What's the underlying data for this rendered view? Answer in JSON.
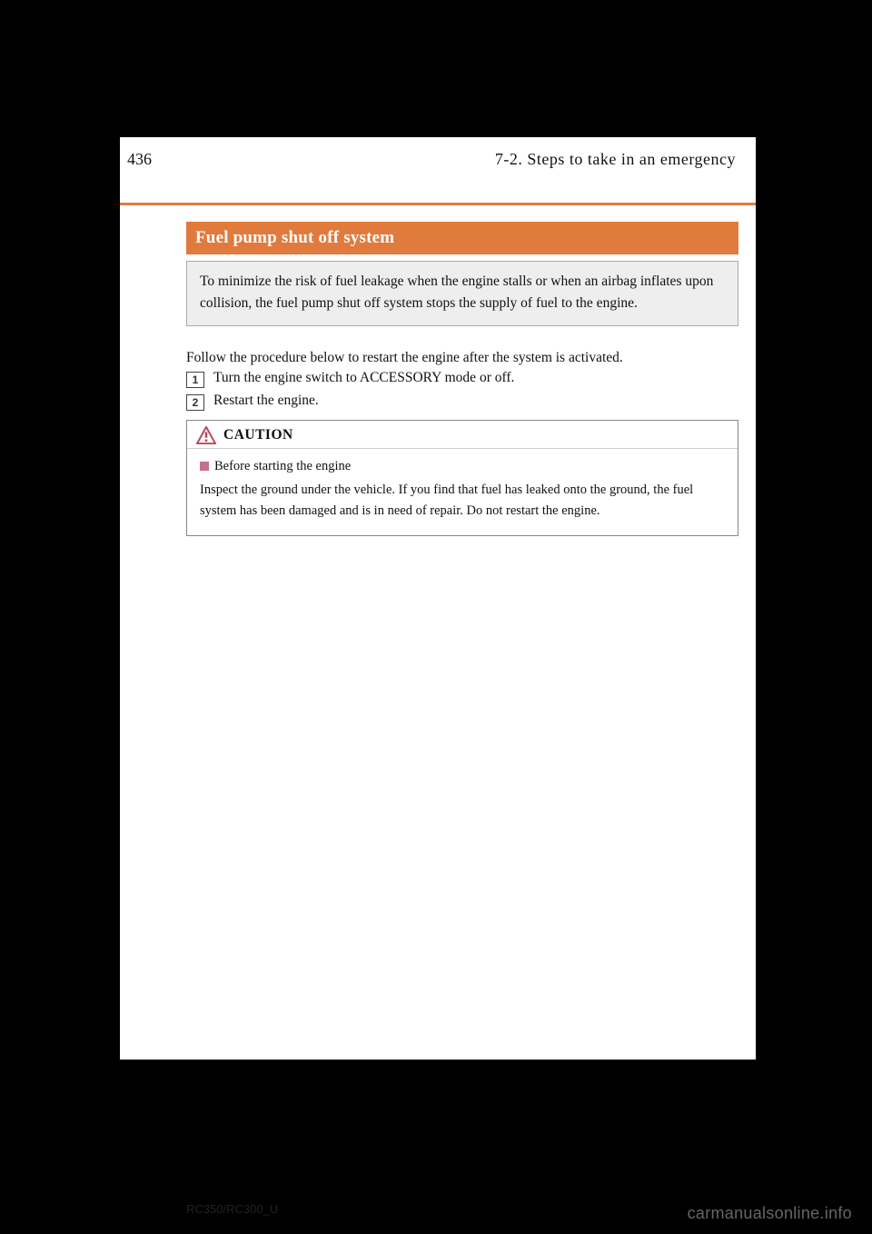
{
  "header": {
    "page_number": "436",
    "breadcrumb": "7-2. Steps to take in an emergency"
  },
  "title": "Fuel pump shut off system",
  "intro": "To minimize the risk of fuel leakage when the engine stalls or when an airbag inflates upon collision, the fuel pump shut off system stops the supply of fuel to the engine.",
  "restart_intro": "Follow the procedure below to restart the engine after the system is activated.",
  "steps": {
    "s1": {
      "num": "1",
      "text": "Turn the engine switch to ACCESSORY mode or off."
    },
    "s2": {
      "num": "2",
      "text": "Restart the engine."
    }
  },
  "caution": {
    "label": "CAUTION",
    "subhead": "Before starting the engine",
    "text": "Inspect the ground under the vehicle. If you find that fuel has leaked onto the ground, the fuel system has been damaged and is in need of repair. Do not restart the engine."
  },
  "footer": {
    "model_code": "RC350/RC300_U",
    "watermark": "carmanualsonline.info"
  }
}
